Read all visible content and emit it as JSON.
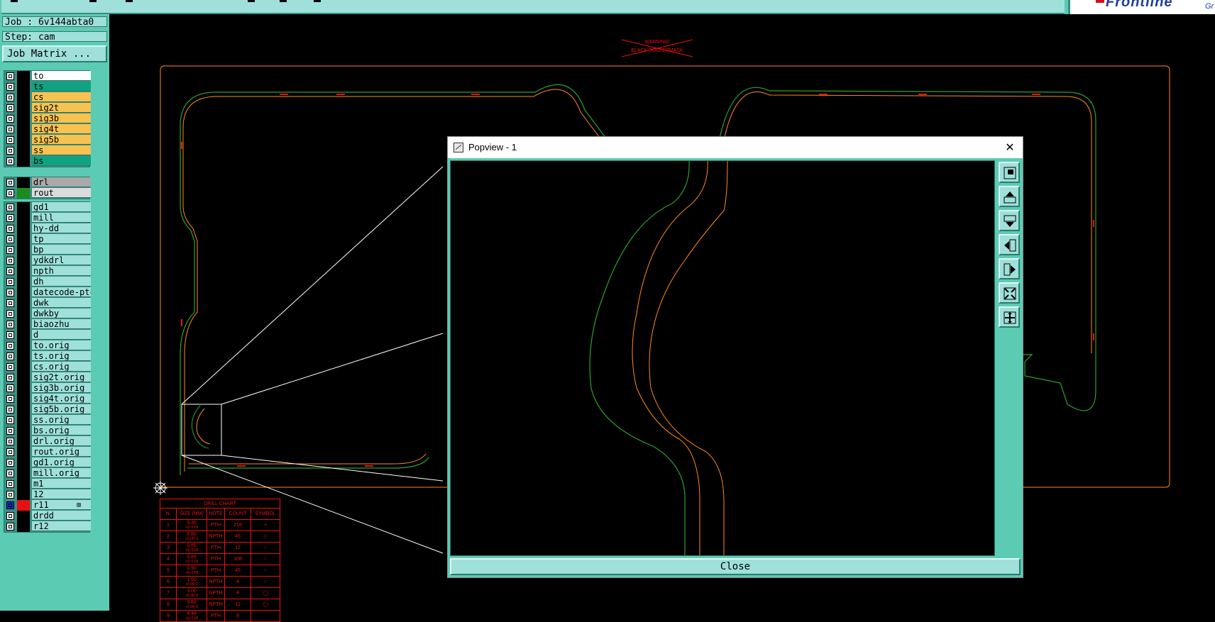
{
  "job": {
    "label": "Job : 6v144abta0",
    "step": "Step: cam",
    "matrix_button": "Job Matrix ..."
  },
  "layers": {
    "board": [
      {
        "name": "to",
        "bg": "#ffffff"
      },
      {
        "name": "ts",
        "bg": "#0fa382"
      },
      {
        "name": "cs",
        "bg": "#f7c24f"
      },
      {
        "name": "sig2t",
        "bg": "#f7c24f"
      },
      {
        "name": "sig3b",
        "bg": "#f7c24f"
      },
      {
        "name": "sig4t",
        "bg": "#f7c24f"
      },
      {
        "name": "sig5b",
        "bg": "#f7c24f"
      },
      {
        "name": "ss",
        "bg": "#f7c24f"
      },
      {
        "name": "bs",
        "bg": "#0fa382"
      }
    ],
    "drill": [
      {
        "name": "drl",
        "bg": "#a9a9a9",
        "swatch": "#000000"
      },
      {
        "name": "rout",
        "bg": "#dcdcdc",
        "swatch": "#1d8a1d"
      }
    ],
    "misc": [
      {
        "name": "gd1",
        "bg": "#9fe0da"
      },
      {
        "name": "mill",
        "bg": "#9fe0da"
      },
      {
        "name": "hy-dd",
        "bg": "#9fe0da"
      },
      {
        "name": "tp",
        "bg": "#9fe0da"
      },
      {
        "name": "bp",
        "bg": "#9fe0da"
      },
      {
        "name": "ydkdrl",
        "bg": "#9fe0da"
      },
      {
        "name": "npth",
        "bg": "#9fe0da"
      },
      {
        "name": "dh",
        "bg": "#9fe0da"
      },
      {
        "name": "datecode-ptc",
        "bg": "#9fe0da"
      },
      {
        "name": "dwk",
        "bg": "#9fe0da"
      },
      {
        "name": "dwkby",
        "bg": "#9fe0da"
      },
      {
        "name": "biaozhu",
        "bg": "#9fe0da"
      },
      {
        "name": "d",
        "bg": "#9fe0da"
      },
      {
        "name": "to.orig",
        "bg": "#9fe0da"
      },
      {
        "name": "ts.orig",
        "bg": "#9fe0da"
      },
      {
        "name": "cs.orig",
        "bg": "#9fe0da"
      },
      {
        "name": "sig2t.orig",
        "bg": "#9fe0da"
      },
      {
        "name": "sig3b.orig",
        "bg": "#9fe0da"
      },
      {
        "name": "sig4t.orig",
        "bg": "#9fe0da"
      },
      {
        "name": "sig5b.orig",
        "bg": "#9fe0da"
      },
      {
        "name": "ss.orig",
        "bg": "#9fe0da"
      },
      {
        "name": "bs.orig",
        "bg": "#9fe0da"
      },
      {
        "name": "drl.orig",
        "bg": "#9fe0da"
      },
      {
        "name": "rout.orig",
        "bg": "#9fe0da"
      },
      {
        "name": "gd1.orig",
        "bg": "#9fe0da"
      },
      {
        "name": "mill.orig",
        "bg": "#9fe0da"
      },
      {
        "name": "m1",
        "bg": "#9fe0da"
      },
      {
        "name": "12",
        "bg": "#9fe0da"
      },
      {
        "name": "r11",
        "bg": "#9fe0da",
        "swatch": "#e81010",
        "selected": true,
        "mark": "⊞"
      },
      {
        "name": "drdd",
        "bg": "#9fe0da"
      },
      {
        "name": "r12",
        "bg": "#9fe0da"
      }
    ]
  },
  "canvas": {
    "warning_line1": "WARNING!",
    "warning_line2": "BLACK SOLDERMASK"
  },
  "drill_chart": {
    "title": "DRILL CHART",
    "headers": [
      "N.",
      "SIZE (MM)",
      "NOTE",
      "COUNT",
      "SYMBOL"
    ],
    "rows": [
      {
        "n": "1",
        "size": "0.35",
        "tol": "+0/-0.08",
        "note": "PTH",
        "count": "216",
        "symbol": "+"
      },
      {
        "n": "2",
        "size": "0.80",
        "tol": "+0.05/-0",
        "note": "NPTH",
        "count": "45",
        "symbol": "◇"
      },
      {
        "n": "3",
        "size": "0.85",
        "tol": "+0/-0.08",
        "note": "PTH",
        "count": "12",
        "symbol": "○"
      },
      {
        "n": "4",
        "size": "0.85",
        "tol": "+0/-0.08",
        "note": "PTH",
        "count": "108",
        "symbol": "○"
      },
      {
        "n": "5",
        "size": "0.90",
        "tol": "+0/-0.08",
        "note": "PTH",
        "count": "45",
        "symbol": "○"
      },
      {
        "n": "6",
        "size": "1.50",
        "tol": "+0.05/-0",
        "note": "NPTH",
        "count": "4",
        "symbol": "○"
      },
      {
        "n": "7",
        "size": "3.00",
        "tol": "+0.05/-0",
        "note": "NPTH",
        "count": "4",
        "symbol": "◯"
      },
      {
        "n": "8",
        "size": "3.80",
        "tol": "+0.05/-0",
        "note": "NPTH",
        "count": "12",
        "symbol": "◯"
      },
      {
        "n": "9",
        "size": "4.44",
        "tol": "+0/-0.08",
        "note": "PTH",
        "count": "9",
        "symbol": ""
      }
    ]
  },
  "popview": {
    "title": "Popview - 1",
    "close_label": "Close",
    "tools": [
      "zoom-window-icon",
      "pan-up-icon",
      "pan-down-icon",
      "pan-left-icon",
      "pan-right-icon",
      "zoom-in-icon",
      "zoom-out-icon"
    ]
  },
  "logo": {
    "text": "Frontline",
    "sub": "Gr"
  },
  "colors": {
    "panel": "#5ccbb4",
    "panel_light": "#9fe0da",
    "outline_orange": "#ff8a1a",
    "rout_green": "#2da12d",
    "drill_red": "#e11"
  }
}
